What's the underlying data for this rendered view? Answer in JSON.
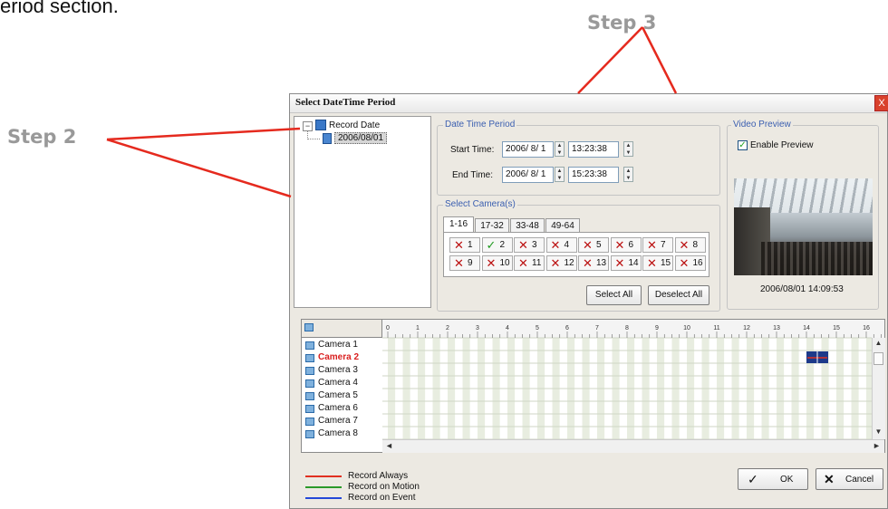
{
  "annotations": {
    "clip_text": "eriod section.",
    "step2": "Step 2",
    "step3": "Step 3"
  },
  "dialog": {
    "title": "Select DateTime Period",
    "close": "X",
    "tree": {
      "root": "Record Date",
      "child": "2006/08/01"
    },
    "datetime": {
      "group": "Date Time Period",
      "start_label": "Start Time:",
      "start_date": "2006/ 8/ 1",
      "start_time": "13:23:38",
      "end_label": "End Time:",
      "end_date": "2006/ 8/ 1",
      "end_time": "15:23:38"
    },
    "cameras": {
      "group": "Select Camera(s)",
      "tabs": [
        "1-16",
        "17-32",
        "33-48",
        "49-64"
      ],
      "items": [
        "1",
        "2",
        "3",
        "4",
        "5",
        "6",
        "7",
        "8",
        "9",
        "10",
        "11",
        "12",
        "13",
        "14",
        "15",
        "16"
      ],
      "checked": [
        2
      ],
      "select_all": "Select All",
      "deselect_all": "Deselect All"
    },
    "preview": {
      "group": "Video Preview",
      "enable_label": "Enable Preview",
      "timestamp": "2006/08/01 14:09:53"
    },
    "timeline": {
      "hours": [
        "0",
        "1",
        "2",
        "3",
        "4",
        "5",
        "6",
        "7",
        "8",
        "9",
        "10",
        "11",
        "12",
        "13",
        "14",
        "15",
        "16"
      ],
      "cameras": [
        "Camera 1",
        "Camera 2",
        "Camera 3",
        "Camera 4",
        "Camera 5",
        "Camera 6",
        "Camera 7",
        "Camera 8"
      ],
      "selected_camera": "Camera 2"
    },
    "legend": {
      "always": "Record Always",
      "motion": "Record on Motion",
      "event": "Record on Event",
      "colors": {
        "always": "#e03020",
        "motion": "#2a9a2a",
        "event": "#2448d8"
      }
    },
    "ok": "OK",
    "cancel": "Cancel"
  }
}
